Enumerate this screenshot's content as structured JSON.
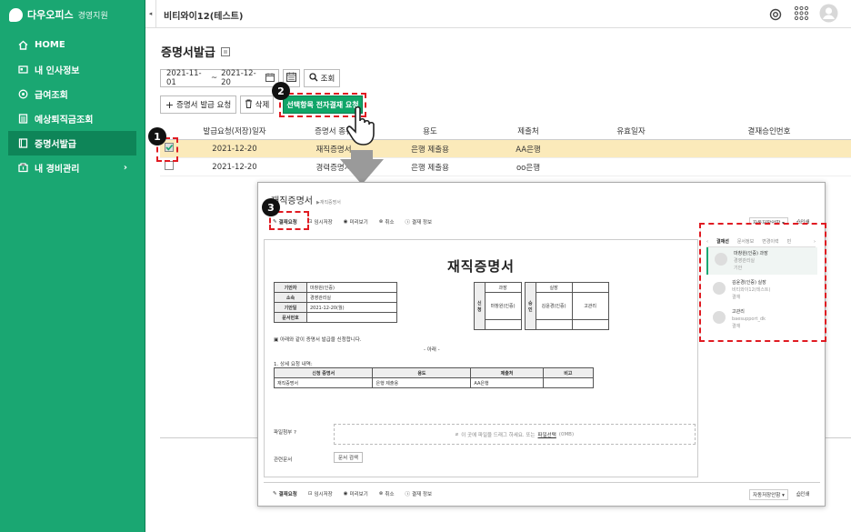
{
  "brand": {
    "name": "다우오피스",
    "sub": "경영지원"
  },
  "sidebar": {
    "items": [
      {
        "label": "HOME",
        "icon": "home-icon"
      },
      {
        "label": "내 인사정보",
        "icon": "id-card-icon"
      },
      {
        "label": "급여조회",
        "icon": "coin-icon"
      },
      {
        "label": "예상퇴직금조회",
        "icon": "calculator-icon"
      },
      {
        "label": "증명서발급",
        "icon": "document-icon"
      },
      {
        "label": "내 경비관리",
        "icon": "wallet-icon",
        "arrow": "›"
      }
    ]
  },
  "topbar": {
    "collapse": "◂",
    "company": "비티와이12(테스트)"
  },
  "page": {
    "title": "증명서발급",
    "date_from": "2021-11-01",
    "date_sep": "~",
    "date_to": "2021-12-20",
    "search_label": "조회",
    "request_label": "증명서 발급 요청",
    "delete_label": "삭제",
    "approve_label": "선택항목 전자결재 요청"
  },
  "table": {
    "headers": [
      "발급요청(저장)일자",
      "증명서 종류",
      "용도",
      "제출처",
      "유효일자",
      "결재승인번호"
    ],
    "rows": [
      {
        "date": "2021-12-20",
        "type": "재직증명서",
        "use": "은행 제출용",
        "to": "AA은행",
        "checked": true
      },
      {
        "date": "2021-12-20",
        "type": "경력증명서",
        "use": "은행 제출용",
        "to": "oo은행",
        "checked": false
      }
    ]
  },
  "badges": [
    "1",
    "2",
    "3"
  ],
  "popup": {
    "title": "재직증명서",
    "sub": "▶재직증명서",
    "toolbar": [
      "결재요청",
      "임시저장",
      "미리보기",
      "취소",
      "결재 정보"
    ],
    "right_select": "자동저장안함",
    "print": "인쇄",
    "doc_title": "재직증명서",
    "info": [
      {
        "k": "기안자",
        "v": "마창원(인증)"
      },
      {
        "k": "소속",
        "v": "경영관리실"
      },
      {
        "k": "기안일",
        "v": "2021-12-20(월)"
      },
      {
        "k": "문서번호",
        "v": ""
      }
    ],
    "approval_left": {
      "side": "신청",
      "role": "과장",
      "name": "마창원(인증)"
    },
    "approval_right": {
      "side": "승인",
      "role": "실장",
      "name1": "김윤경(인증)",
      "name2": "고관리"
    },
    "notice": "▣ 아래와 같이 증명서 발급을 신청합니다.",
    "below": "- 아래 -",
    "section": "1. 상세 요청 내역:",
    "detail_headers": [
      "신청 증명서",
      "용도",
      "제출처",
      "비고"
    ],
    "detail_row": [
      "재직증명서",
      "은행 제출용",
      "AA은행",
      ""
    ],
    "attach_label": "파일첨부",
    "attach_hint": "이 곳에 파일을 드래그 하세요. 또는",
    "attach_link": "파일선택",
    "attach_size": "(0MB)",
    "related_label": "관련문서",
    "related_btn": "문서 검색"
  },
  "panel": {
    "tabs": [
      "결재선",
      "문서정보",
      "변경이력",
      "빈"
    ],
    "items": [
      {
        "name": "마창원(인증) 과장",
        "dept": "경영관리실",
        "state": "기안"
      },
      {
        "name": "김윤경(인증) 실장",
        "dept": "비티와이12(테스트)",
        "state": "결재"
      },
      {
        "name": "고관리",
        "dept": "baesupport_dk",
        "state": "결재"
      }
    ]
  },
  "colors": {
    "accent": "#1aa772",
    "highlight": "#fbeaba",
    "danger": "#e01b22"
  }
}
